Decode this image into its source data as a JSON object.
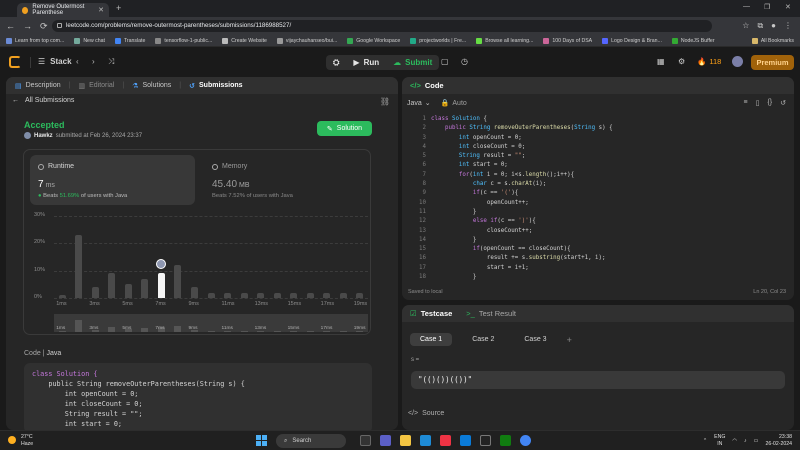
{
  "browser": {
    "tab_title": "Remove Outermost Parenthese",
    "url": "leetcode.com/problems/remove-outermost-parentheses/submissions/1186988527/",
    "bookmarks": [
      "Learn from top com...",
      "New chat",
      "Translate",
      "tensorflow-1-public...",
      "Create Website",
      "vijaychauhanseo/bui...",
      "Google Workspace",
      "projectworlds | Fre...",
      "Browse all learning...",
      "100 Days of DSA",
      "Logo Design & Bran...",
      "NodeJS Buffer"
    ],
    "all_bookmarks": "All Bookmarks"
  },
  "header": {
    "problem_list": "Stack",
    "run": "Run",
    "submit": "Submit",
    "streak": "118",
    "premium": "Premium"
  },
  "left": {
    "tabs": [
      {
        "label": "Description"
      },
      {
        "label": "Editorial"
      },
      {
        "label": "Solutions"
      },
      {
        "label": "Submissions"
      }
    ],
    "back": "All Submissions",
    "status": "Accepted",
    "user": "Hawkz",
    "submitted": "submitted at Feb 26, 2024 23:37",
    "solution_btn": "Solution",
    "runtime": {
      "label": "Runtime",
      "value": "7",
      "unit": "ms",
      "beats_prefix": "Beats",
      "beats_pct": "51.69%",
      "beats_suffix": "of users with Java"
    },
    "memory": {
      "label": "Memory",
      "value": "45.40",
      "unit": "MB",
      "beats": "Beats 7.52% of users with Java"
    },
    "code_label": "Code",
    "code_lang": "Java",
    "code_lines": [
      "class Solution {",
      "    public String removeOuterParentheses(String s) {",
      "        int openCount = 0;",
      "        int closeCount = 0;",
      "        String result = \"\";",
      "        int start = 0;"
    ]
  },
  "chart_data": {
    "type": "bar",
    "title": "",
    "xlabel": "",
    "ylabel": "",
    "ylim": [
      0,
      30
    ],
    "yticks": [
      "30%",
      "20%",
      "10%",
      "0%"
    ],
    "categories": [
      "1ms",
      "2ms",
      "3ms",
      "4ms",
      "5ms",
      "6ms",
      "7ms",
      "8ms",
      "9ms",
      "10ms",
      "11ms",
      "12ms",
      "13ms",
      "14ms",
      "15ms",
      "16ms",
      "17ms",
      "18ms",
      "19ms"
    ],
    "x_tick_labels": [
      "1ms",
      "3ms",
      "5ms",
      "7ms",
      "9ms",
      "11ms",
      "13ms",
      "15ms",
      "17ms",
      "19ms"
    ],
    "values": [
      1,
      23,
      4,
      9,
      5,
      7,
      9,
      12,
      4,
      2,
      2,
      2,
      2,
      2,
      2,
      2,
      2,
      2,
      2
    ],
    "highlight": "7ms",
    "series": [
      {
        "values": [
          1,
          23,
          4,
          9,
          5,
          7,
          9,
          12,
          4,
          2,
          2,
          2,
          2,
          2,
          2,
          2,
          2,
          2,
          2
        ]
      }
    ]
  },
  "editor": {
    "title": "Code",
    "language": "Java",
    "mode": "Auto",
    "line_numbers": [
      "1",
      "2",
      "3",
      "4",
      "5",
      "6",
      "7",
      "8",
      "9",
      "10",
      "11",
      "12",
      "13",
      "14",
      "15",
      "16",
      "17",
      "18"
    ],
    "saved": "Saved to local",
    "cursor": "Ln 20, Col 23"
  },
  "testcase": {
    "tab": "Testcase",
    "result_tab": "Test Result",
    "cases": [
      "Case 1",
      "Case 2",
      "Case 3"
    ],
    "var": "s =",
    "input": "\"(()())(())\"",
    "source": "Source"
  },
  "taskbar": {
    "temp": "27°C",
    "weather": "Haze",
    "search": "Search",
    "lang_top": "ENG",
    "lang_bottom": "IN",
    "time": "23:38",
    "date": "26-02-2024"
  }
}
